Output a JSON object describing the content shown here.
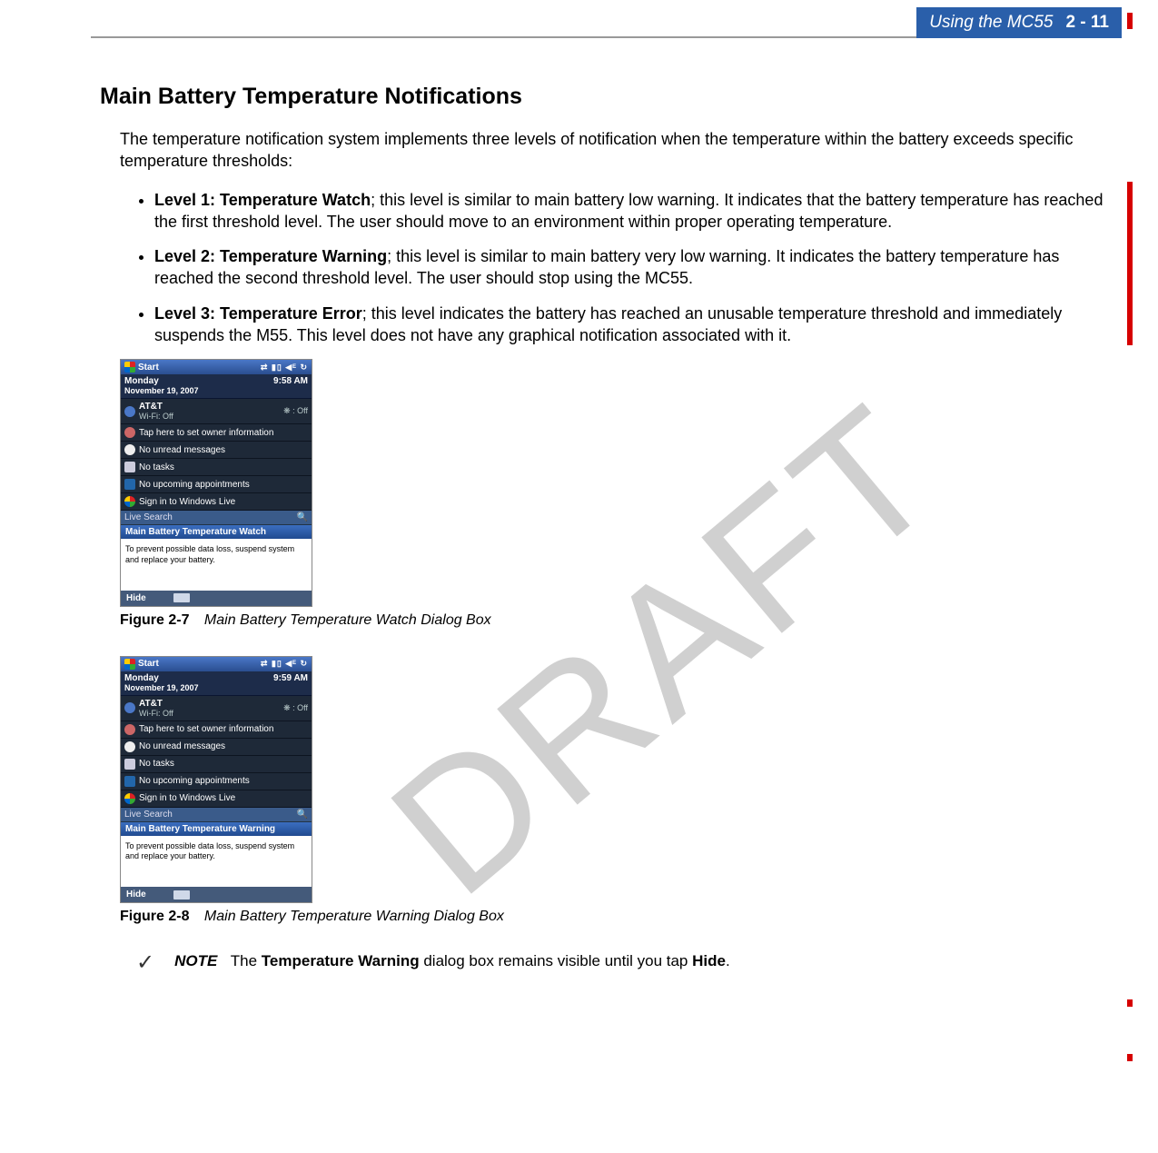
{
  "header": {
    "chapter_title": "Using the MC55",
    "page_number": "2 - 11"
  },
  "section_heading": "Main Battery Temperature Notifications",
  "intro_paragraph": "The temperature notification system implements three levels of notification when the temperature within the battery exceeds specific temperature thresholds:",
  "levels": [
    {
      "label": "Level 1: Temperature Watch",
      "text": "; this level is similar to main battery low warning. It indicates that the battery temperature has reached the first threshold level. The user should move to an environment within proper operating temperature."
    },
    {
      "label": "Level 2: Temperature Warning",
      "text": "; this level is similar to main battery very low warning. It indicates the battery temperature has reached the second threshold level. The user should stop using the MC55."
    },
    {
      "label": "Level 3: Temperature Error",
      "text": "; this level indicates the battery has reached an unusable temperature threshold and immediately suspends the M55. This level does not have any graphical notification associated with it."
    }
  ],
  "watermark": "DRAFT",
  "screenshots": [
    {
      "start_label": "Start",
      "status_icons": "⇄ ▮▯ ◀ᴱ ↻",
      "day": "Monday",
      "date": "November 19, 2007",
      "time": "9:58 AM",
      "carrier": "AT&T",
      "wifi": "Wi-Fi: Off",
      "bt": "❋ : Off",
      "rows": [
        "Tap here to set owner information",
        "No unread messages",
        "No tasks",
        "No upcoming appointments",
        "Sign in to Windows Live"
      ],
      "search_label": "Live Search",
      "dialog_title": "Main Battery Temperature Watch",
      "dialog_body": "To prevent possible data loss, suspend system and replace your battery.",
      "hide_label": "Hide"
    },
    {
      "start_label": "Start",
      "status_icons": "⇄ ▮▯ ◀ᴱ ↻",
      "day": "Monday",
      "date": "November 19, 2007",
      "time": "9:59 AM",
      "carrier": "AT&T",
      "wifi": "Wi-Fi: Off",
      "bt": "❋ : Off",
      "rows": [
        "Tap here to set owner information",
        "No unread messages",
        "No tasks",
        "No upcoming appointments",
        "Sign in to Windows Live"
      ],
      "search_label": "Live Search",
      "dialog_title": "Main Battery Temperature Warning",
      "dialog_body": "To prevent possible data loss, suspend system and replace your battery.",
      "hide_label": "Hide"
    }
  ],
  "figures": [
    {
      "label": "Figure 2-7",
      "caption": "Main Battery Temperature Watch Dialog Box"
    },
    {
      "label": "Figure 2-8",
      "caption": "Main Battery Temperature Warning Dialog Box"
    }
  ],
  "note": {
    "label": "NOTE",
    "prefix": "The ",
    "bold1": "Temperature Warning",
    "mid": " dialog box remains visible until you tap ",
    "bold2": "Hide",
    "suffix": "."
  }
}
